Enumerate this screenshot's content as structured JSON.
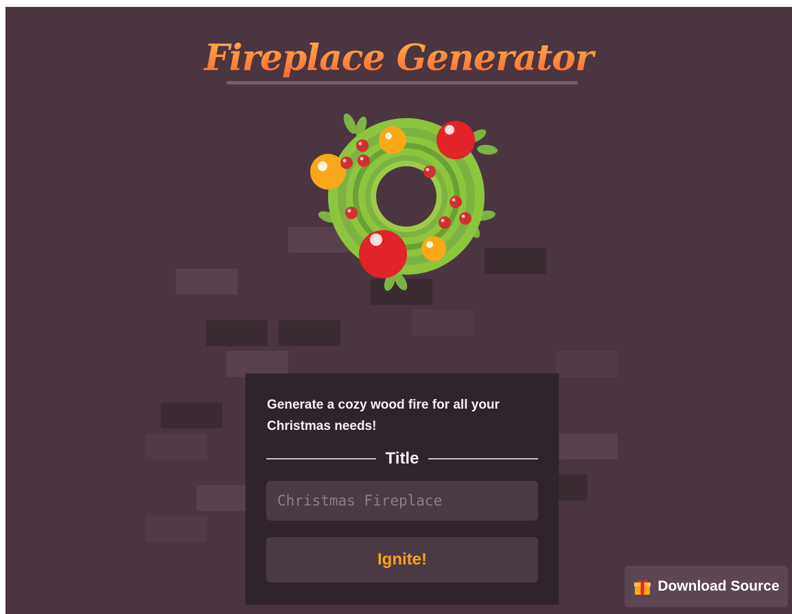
{
  "header": {
    "title": "Fireplace Generator"
  },
  "panel": {
    "description": "Generate a cozy wood fire for all your Christmas needs!",
    "section_label": "Title",
    "title_input": {
      "value": "",
      "placeholder": "Christmas Fireplace"
    },
    "ignite_label": "Ignite!"
  },
  "footer": {
    "download_label": "Download Source",
    "download_icon": "gift-icon"
  },
  "colors": {
    "background": "#4a3541",
    "panel": "#2f242b",
    "title_accent": "#ff8a3d",
    "ignite_text": "#f7a21b",
    "wreath_green": "#8cc63f",
    "ornament_red": "#e02428",
    "ornament_gold": "#f9a81a"
  }
}
